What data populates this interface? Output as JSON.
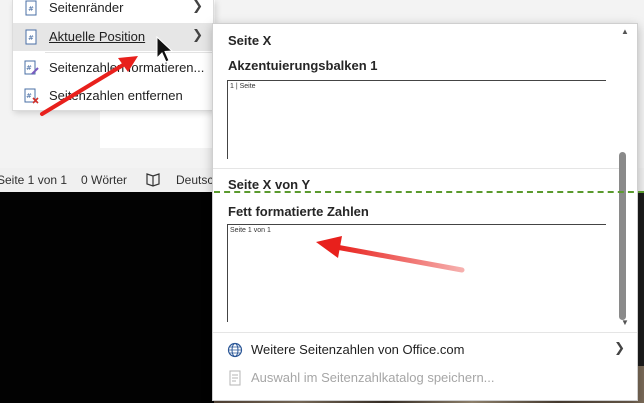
{
  "menu": {
    "items": [
      {
        "label": "Seitenränder",
        "icon": "page-margins-icon",
        "has_submenu": true
      },
      {
        "label": "Aktuelle Position",
        "icon": "current-position-icon",
        "has_submenu": true,
        "highlighted": true
      },
      {
        "label": "Seitenzahlen formatieren...",
        "icon": "format-page-numbers-icon",
        "has_submenu": false
      },
      {
        "label": "Seitenzahlen entfernen",
        "icon": "remove-page-numbers-icon",
        "has_submenu": false
      }
    ]
  },
  "statusbar": {
    "page": "Seite 1 von 1",
    "words": "0 Wörter",
    "language": "Deutsch"
  },
  "gallery": {
    "section1_title": "Seite X",
    "item1_title": "Akzentuierungsbalken 1",
    "item1_preview": "1 | Seite",
    "section2_title": "Seite X von Y",
    "item2_title": "Fett formatierte Zahlen",
    "item2_preview": "Seite 1 von 1",
    "footer_more": "Weitere Seitenzahlen von Office.com",
    "footer_save": "Auswahl im Seitenzahlkatalog speichern..."
  },
  "colors": {
    "annotation_arrow": "#e8201c",
    "dashed_line": "#5a9a2e"
  }
}
